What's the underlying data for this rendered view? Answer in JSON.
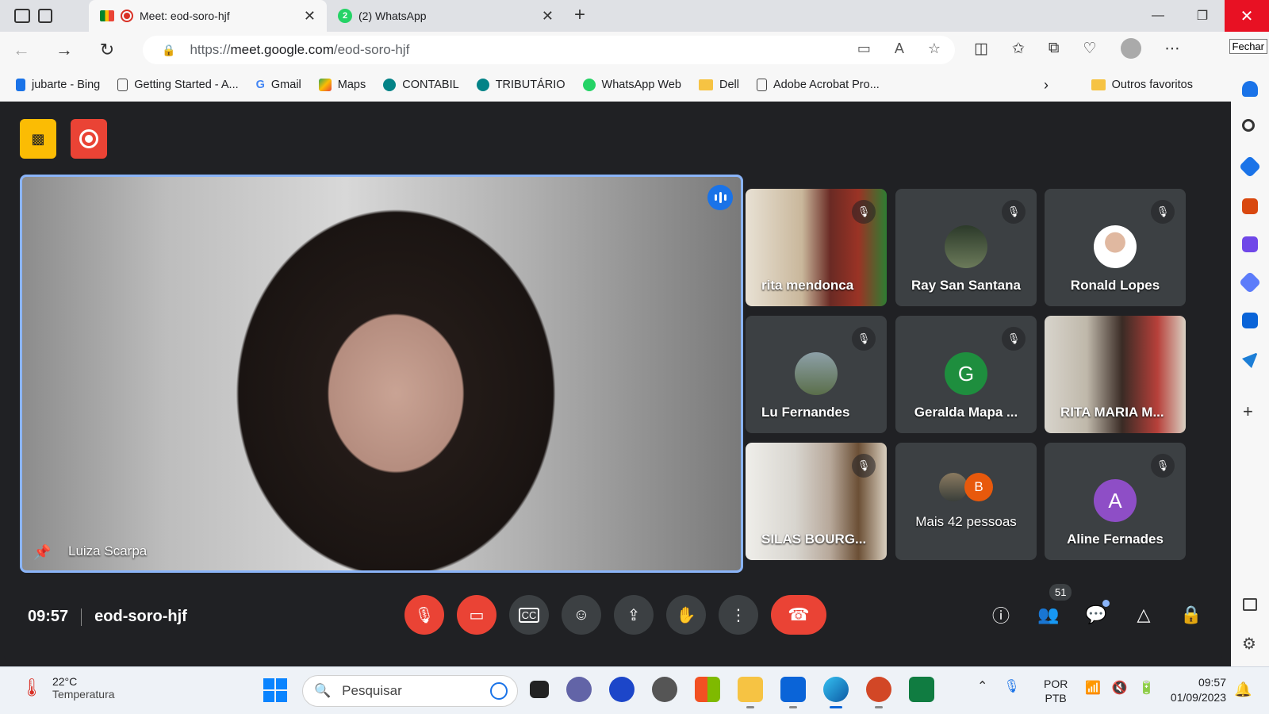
{
  "browser": {
    "tabs": [
      {
        "title": "Meet: eod-soro-hjf",
        "active": true
      },
      {
        "title": "(2) WhatsApp",
        "active": false,
        "badge": "2"
      }
    ],
    "url_scheme": "https://",
    "url_host": "meet.google.com",
    "url_path": "/eod-soro-hjf",
    "close_tooltip": "Fechar",
    "bookmarks": [
      {
        "label": "jubarte - Bing",
        "icon": "bing-icon"
      },
      {
        "label": "Getting Started - A...",
        "icon": "page-icon"
      },
      {
        "label": "Gmail",
        "icon": "google-icon"
      },
      {
        "label": "Maps",
        "icon": "maps-icon"
      },
      {
        "label": "CONTABIL",
        "icon": "sharepoint-icon"
      },
      {
        "label": "TRIBUTÁRIO",
        "icon": "sharepoint-icon"
      },
      {
        "label": "WhatsApp Web",
        "icon": "whatsapp-icon"
      },
      {
        "label": "Dell",
        "icon": "folder-icon"
      },
      {
        "label": "Adobe Acrobat Pro...",
        "icon": "page-icon"
      }
    ],
    "other_favorites": "Outros favoritos"
  },
  "meet": {
    "main_speaker": "Luiza Scarpa",
    "participants": [
      {
        "name": "rita mendonca",
        "muted": true,
        "type": "video"
      },
      {
        "name": "Ray San Santana",
        "muted": true,
        "type": "photo-avatar"
      },
      {
        "name": "Ronald Lopes",
        "muted": true,
        "type": "photo-avatar"
      },
      {
        "name": "Lu Fernandes",
        "muted": true,
        "type": "photo-avatar"
      },
      {
        "name": "Geralda Mapa ...",
        "muted": true,
        "type": "letter-avatar",
        "letter": "G"
      },
      {
        "name": "RITA MARIA M...",
        "muted": false,
        "type": "video"
      },
      {
        "name": "SILAS BOURG...",
        "muted": true,
        "type": "video"
      },
      {
        "name": "Mais 42 pessoas",
        "muted": false,
        "type": "more",
        "letter": "B"
      },
      {
        "name": "Aline Fernades",
        "muted": true,
        "type": "letter-avatar",
        "letter": "A"
      }
    ],
    "time": "09:57",
    "meeting_code": "eod-soro-hjf",
    "participant_count": "51"
  },
  "colors": {
    "accent_blue": "#8ab4f8",
    "danger_red": "#ea4335",
    "green_avatar": "#1e8e3e",
    "purple_avatar": "#8e4ec6",
    "orange_avatar": "#e8590c"
  },
  "taskbar": {
    "temperature": "22°C",
    "weather_label": "Temperatura",
    "search_placeholder": "Pesquisar",
    "lang_line1": "POR",
    "lang_line2": "PTB",
    "clock_time": "09:57",
    "clock_date": "01/09/2023"
  }
}
